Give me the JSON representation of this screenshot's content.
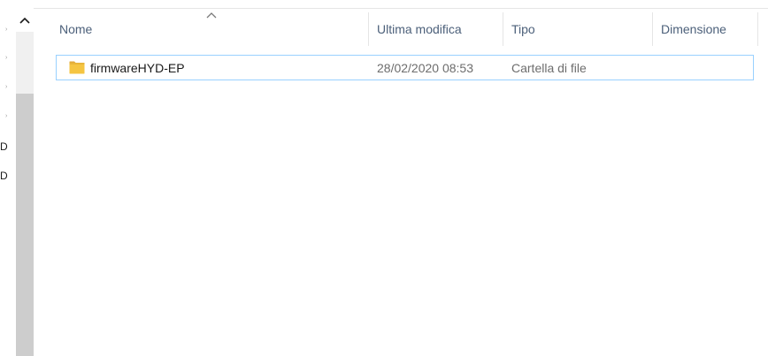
{
  "nav": {
    "labels": [
      "D",
      "D"
    ]
  },
  "columns": {
    "name": "Nome",
    "modified": "Ultima modifica",
    "type": "Tipo",
    "size": "Dimensione"
  },
  "files": [
    {
      "name": "firmwareHYD-EP",
      "modified": "28/02/2020 08:53",
      "type": "Cartella di file",
      "size": "",
      "icon": "folder-icon"
    }
  ],
  "colors": {
    "header_text": "#4c607a",
    "selection_border": "#99d1ff",
    "folder": "#f5c542"
  }
}
